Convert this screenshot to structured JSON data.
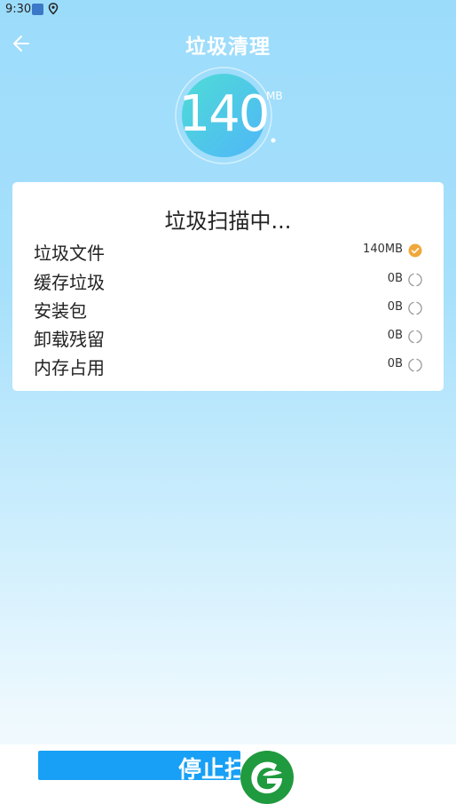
{
  "status_bar": {
    "time": "9:30"
  },
  "header": {
    "title": "垃圾清理"
  },
  "gauge": {
    "value": "140",
    "unit": "MB"
  },
  "scan": {
    "title": "垃圾扫描中...",
    "rows": [
      {
        "label": "垃圾文件",
        "size": "140MB",
        "status": "done"
      },
      {
        "label": "缓存垃圾",
        "size": "0B",
        "status": "scanning"
      },
      {
        "label": "安装包",
        "size": "0B",
        "status": "scanning"
      },
      {
        "label": "卸载残留",
        "size": "0B",
        "status": "scanning"
      },
      {
        "label": "内存占用",
        "size": "0B",
        "status": "scanning"
      }
    ]
  },
  "footer": {
    "stop_label": "停止扫描"
  },
  "colors": {
    "accent": "#17a0f5",
    "done": "#f0a83c",
    "gauge_teal": "#4fd8e0",
    "gauge_blue": "#4fc0f5"
  }
}
